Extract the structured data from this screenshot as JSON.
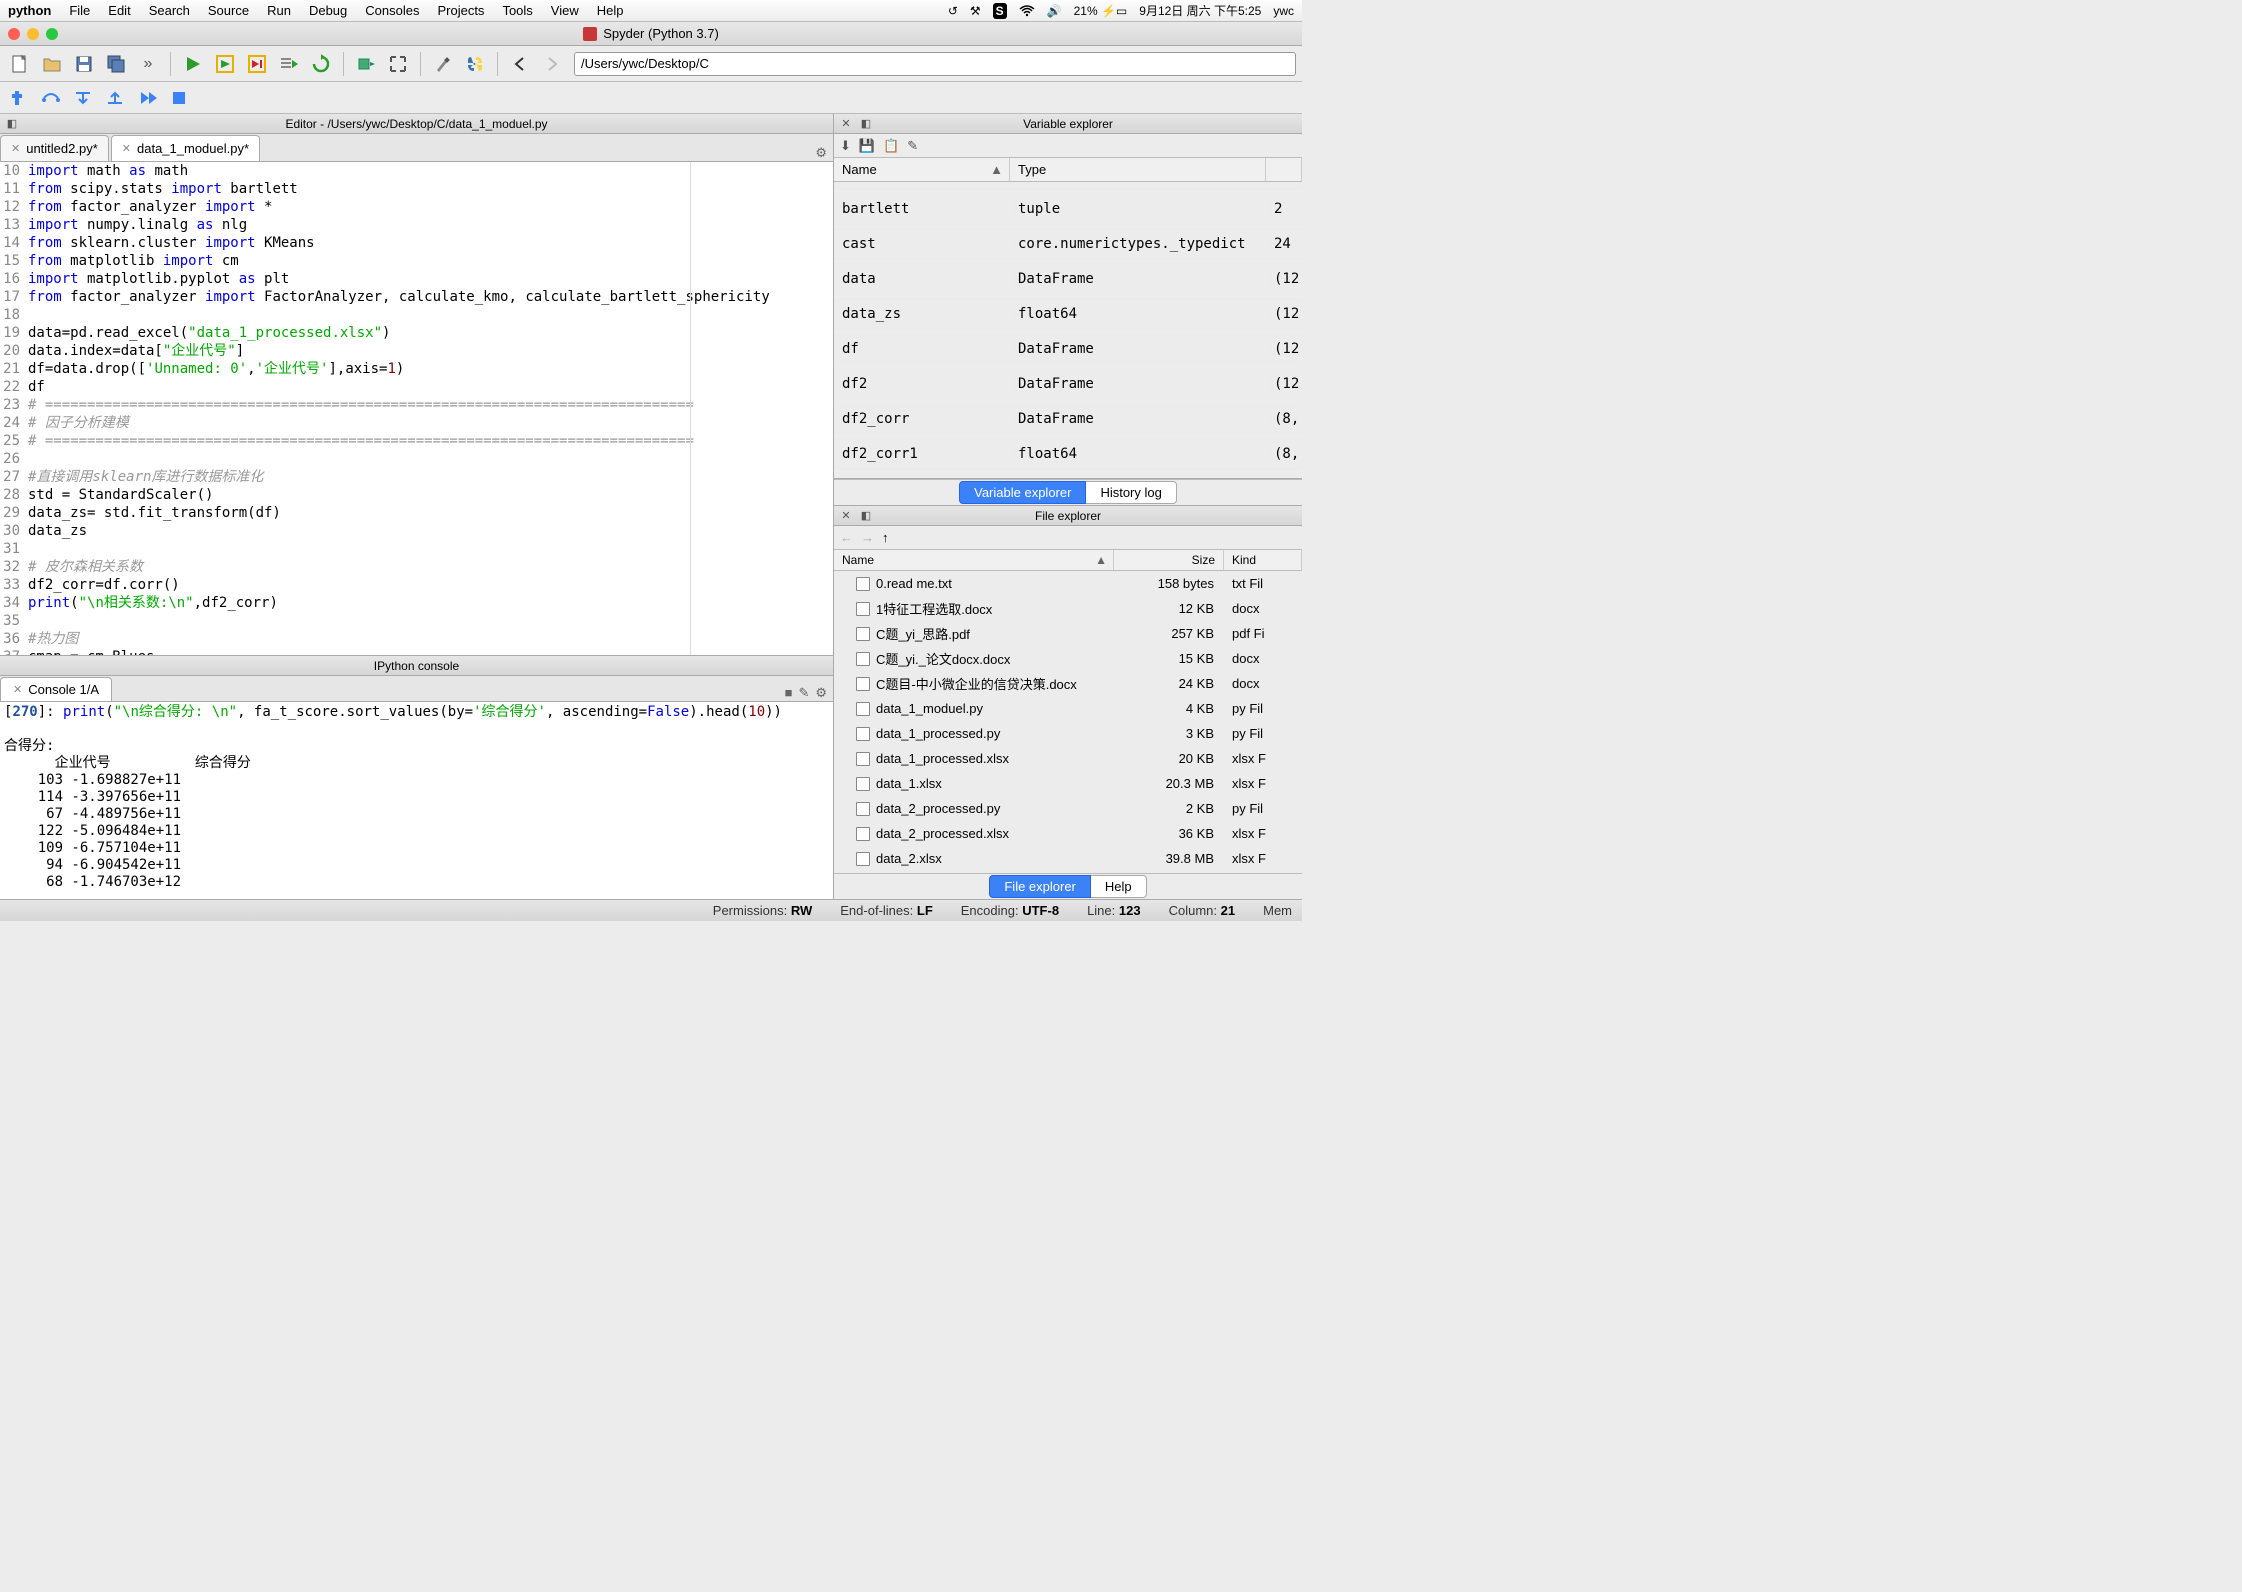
{
  "menubar": {
    "app": "python",
    "items": [
      "File",
      "Edit",
      "Search",
      "Source",
      "Run",
      "Debug",
      "Consoles",
      "Projects",
      "Tools",
      "View",
      "Help"
    ],
    "right": {
      "battery": "21%",
      "date": "9月12日 周六 下午5:25",
      "user": "ywc"
    }
  },
  "window_title": "Spyder (Python 3.7)",
  "path": "/Users/ywc/Desktop/C",
  "editor": {
    "header": "Editor - /Users/ywc/Desktop/C/data_1_moduel.py",
    "tabs": [
      {
        "label": "untitled2.py*",
        "active": false
      },
      {
        "label": "data_1_moduel.py*",
        "active": true
      }
    ],
    "first_line": 10,
    "lines": [
      {
        "t": "code",
        "tokens": [
          [
            "kw",
            "import"
          ],
          [
            "",
            " math "
          ],
          [
            "kw",
            "as"
          ],
          [
            "",
            " math"
          ]
        ]
      },
      {
        "t": "code",
        "tokens": [
          [
            "kw",
            "from"
          ],
          [
            "",
            " scipy.stats "
          ],
          [
            "kw",
            "import"
          ],
          [
            "",
            " bartlett"
          ]
        ]
      },
      {
        "t": "code",
        "tokens": [
          [
            "kw",
            "from"
          ],
          [
            "",
            " factor_analyzer "
          ],
          [
            "kw",
            "import"
          ],
          [
            "",
            " *"
          ]
        ]
      },
      {
        "t": "code",
        "tokens": [
          [
            "kw",
            "import"
          ],
          [
            "",
            " numpy.linalg "
          ],
          [
            "kw",
            "as"
          ],
          [
            "",
            " nlg"
          ]
        ]
      },
      {
        "t": "code",
        "tokens": [
          [
            "kw",
            "from"
          ],
          [
            "",
            " sklearn.cluster "
          ],
          [
            "kw",
            "import"
          ],
          [
            "",
            " KMeans"
          ]
        ]
      },
      {
        "t": "code",
        "tokens": [
          [
            "kw",
            "from"
          ],
          [
            "",
            " matplotlib "
          ],
          [
            "kw",
            "import"
          ],
          [
            "",
            " cm"
          ]
        ]
      },
      {
        "t": "code",
        "tokens": [
          [
            "kw",
            "import"
          ],
          [
            "",
            " matplotlib.pyplot "
          ],
          [
            "kw",
            "as"
          ],
          [
            "",
            " plt"
          ]
        ]
      },
      {
        "t": "code",
        "tokens": [
          [
            "kw",
            "from"
          ],
          [
            "",
            " factor_analyzer "
          ],
          [
            "kw",
            "import"
          ],
          [
            "",
            " FactorAnalyzer, calculate_kmo, calculate_bartlett_sphericity"
          ]
        ]
      },
      {
        "t": "blank"
      },
      {
        "t": "code",
        "tokens": [
          [
            "",
            "data=pd.read_excel("
          ],
          [
            "str",
            "\"data_1_processed.xlsx\""
          ],
          [
            "",
            ")"
          ]
        ]
      },
      {
        "t": "code",
        "tokens": [
          [
            "",
            "data.index=data["
          ],
          [
            "str",
            "\"企业代号\""
          ],
          [
            "",
            "]"
          ]
        ]
      },
      {
        "t": "code",
        "tokens": [
          [
            "",
            "df=data.drop(["
          ],
          [
            "str",
            "'Unnamed: 0'"
          ],
          [
            "",
            ","
          ],
          [
            "str",
            "'企业代号'"
          ],
          [
            "",
            "],axis="
          ],
          [
            "num",
            "1"
          ],
          [
            "",
            ")"
          ]
        ]
      },
      {
        "t": "code",
        "tokens": [
          [
            "",
            "df"
          ]
        ]
      },
      {
        "t": "cmt",
        "text": "# ============================================================================="
      },
      {
        "t": "cmt",
        "text": "# 因子分析建模"
      },
      {
        "t": "cmt",
        "text": "# ============================================================================="
      },
      {
        "t": "blank"
      },
      {
        "t": "cmt",
        "text": "#直接调用sklearn库进行数据标准化"
      },
      {
        "t": "code",
        "tokens": [
          [
            "",
            "std = StandardScaler()"
          ]
        ]
      },
      {
        "t": "code",
        "tokens": [
          [
            "",
            "data_zs= std.fit_transform(df)"
          ]
        ]
      },
      {
        "t": "code",
        "tokens": [
          [
            "",
            "data_zs"
          ]
        ]
      },
      {
        "t": "blank"
      },
      {
        "t": "cmt",
        "text": "# 皮尔森相关系数"
      },
      {
        "t": "code",
        "tokens": [
          [
            "",
            "df2_corr=df.corr()"
          ]
        ]
      },
      {
        "t": "code",
        "tokens": [
          [
            "kw",
            "print"
          ],
          [
            "",
            "("
          ],
          [
            "str",
            "\"\\n相关系数:\\n\""
          ],
          [
            "",
            ",df2_corr)"
          ]
        ]
      },
      {
        "t": "blank"
      },
      {
        "t": "cmt",
        "text": "#热力图"
      },
      {
        "t": "code",
        "tokens": [
          [
            "",
            "cmap = cm.Blues"
          ]
        ]
      }
    ]
  },
  "console": {
    "header": "IPython console",
    "tab": "Console 1/A",
    "prompt_num": "270",
    "cmd_tokens": [
      [
        "kw",
        "print"
      ],
      [
        "",
        "("
      ],
      [
        "str",
        "\"\\n综合得分: \\n\""
      ],
      [
        "",
        ", fa_t_score.sort_values(by="
      ],
      [
        "str",
        "'综合得分'"
      ],
      [
        "",
        ", ascending="
      ],
      [
        "kw",
        "False"
      ],
      [
        "",
        ").head("
      ],
      [
        "num",
        "10"
      ],
      [
        "",
        "))"
      ]
    ],
    "output": [
      "合得分:",
      "      企业代号          综合得分",
      "    103 -1.698827e+11",
      "    114 -3.397656e+11",
      "     67 -4.489756e+11",
      "    122 -5.096484e+11",
      "    109 -6.757104e+11",
      "     94 -6.904542e+11",
      "     68 -1.746703e+12"
    ]
  },
  "var_explorer": {
    "header": "Variable explorer",
    "cols": [
      "Name",
      "Type"
    ],
    "rows": [
      {
        "name": "bartlett",
        "type": "tuple",
        "extra": "2"
      },
      {
        "name": "cast",
        "type": "core.numerictypes._typedict",
        "extra": "24"
      },
      {
        "name": "data",
        "type": "DataFrame",
        "extra": "(12"
      },
      {
        "name": "data_zs",
        "type": "float64",
        "extra": "(12"
      },
      {
        "name": "df",
        "type": "DataFrame",
        "extra": "(12"
      },
      {
        "name": "df2",
        "type": "DataFrame",
        "extra": "(12"
      },
      {
        "name": "df2_corr",
        "type": "DataFrame",
        "extra": "(8,"
      },
      {
        "name": "df2_corr1",
        "type": "float64",
        "extra": "(8,"
      }
    ],
    "tabs": [
      "Variable explorer",
      "History log"
    ]
  },
  "file_explorer": {
    "header": "File explorer",
    "cols": [
      "Name",
      "Size",
      "Kind"
    ],
    "rows": [
      {
        "name": "0.read me.txt",
        "size": "158 bytes",
        "kind": "txt Fil"
      },
      {
        "name": "1特征工程选取.docx",
        "size": "12 KB",
        "kind": "docx"
      },
      {
        "name": "C题_yi_思路.pdf",
        "size": "257 KB",
        "kind": "pdf Fi"
      },
      {
        "name": "C题_yi._论文docx.docx",
        "size": "15 KB",
        "kind": "docx"
      },
      {
        "name": "C题目-中小微企业的信贷决策.docx",
        "size": "24 KB",
        "kind": "docx"
      },
      {
        "name": "data_1_moduel.py",
        "size": "4 KB",
        "kind": "py Fil"
      },
      {
        "name": "data_1_processed.py",
        "size": "3 KB",
        "kind": "py Fil"
      },
      {
        "name": "data_1_processed.xlsx",
        "size": "20 KB",
        "kind": "xlsx F"
      },
      {
        "name": "data_1.xlsx",
        "size": "20.3 MB",
        "kind": "xlsx F"
      },
      {
        "name": "data_2_processed.py",
        "size": "2 KB",
        "kind": "py Fil"
      },
      {
        "name": "data_2_processed.xlsx",
        "size": "36 KB",
        "kind": "xlsx F"
      },
      {
        "name": "data_2.xlsx",
        "size": "39.8 MB",
        "kind": "xlsx F"
      }
    ],
    "tabs": [
      "File explorer",
      "Help"
    ]
  },
  "statusbar": {
    "permissions": {
      "label": "Permissions:",
      "val": "RW"
    },
    "eol": {
      "label": "End-of-lines:",
      "val": "LF"
    },
    "encoding": {
      "label": "Encoding:",
      "val": "UTF-8"
    },
    "line": {
      "label": "Line:",
      "val": "123"
    },
    "column": {
      "label": "Column:",
      "val": "21"
    },
    "mem": {
      "label": "Mem",
      "val": ""
    }
  }
}
